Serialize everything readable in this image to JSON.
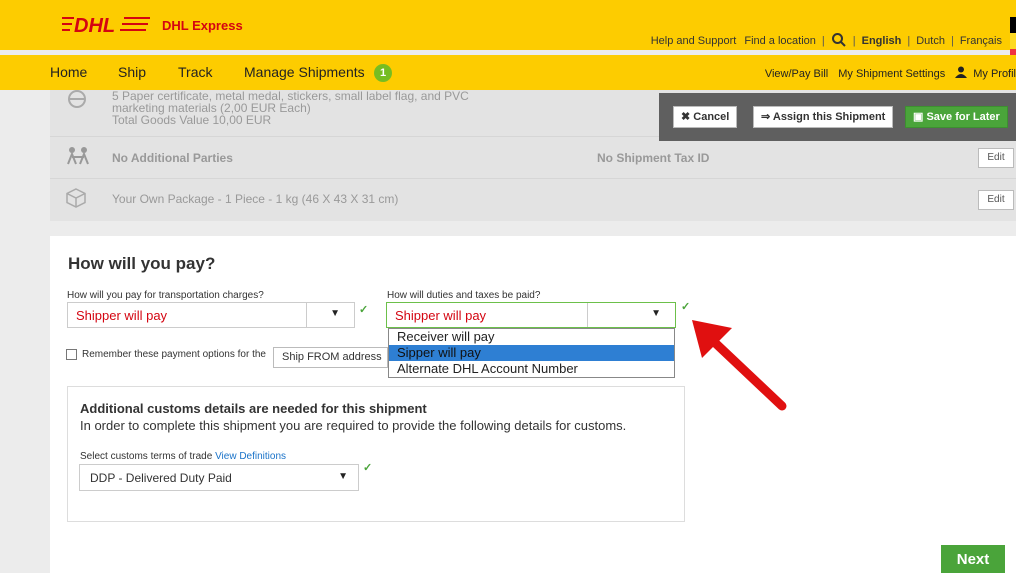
{
  "header": {
    "brand": "DHL Express",
    "links": [
      "Help and Support",
      "Find a location"
    ],
    "languages": [
      "English",
      "Dutch",
      "Français"
    ],
    "active_language": "English",
    "flag_colors": [
      "#000000",
      "#fdda24",
      "#ef3340"
    ]
  },
  "nav": {
    "home": "Home",
    "ship": "Ship",
    "track": "Track",
    "manage": "Manage Shipments",
    "badge": "1",
    "right": [
      "View/Pay Bill",
      "My Shipment Settings",
      "My Profil"
    ]
  },
  "summary": {
    "goods_line1": "5 Paper certificate, metal medal, stickers, small label flag, and PVC",
    "goods_line2": "marketing materials (2,00 EUR Each)",
    "goods_line3": "Total Goods Value 10,00 EUR",
    "parties": "No Additional Parties",
    "tax_id": "No Shipment Tax ID",
    "package": "Your Own Package - 1 Piece - 1 kg (46 X 43 X 31 cm)",
    "edit_label": "Edit"
  },
  "actions": {
    "cancel": "Cancel",
    "assign": "Assign this Shipment",
    "save": "Save for Later"
  },
  "payment": {
    "heading": "How will you pay?",
    "transport_label": "How will you pay for transportation charges?",
    "transport_value": "Shipper will pay",
    "duties_label": "How will duties and taxes be paid?",
    "duties_value": "Shipper will pay",
    "duties_options": [
      "Receiver will pay",
      "Sipper will pay",
      "Alternate DHL Account Number"
    ],
    "remember_label": "Remember these payment options for the",
    "remember_select": "Ship FROM address"
  },
  "customs": {
    "title": "Additional customs details are needed for this shipment",
    "text": "In order to complete this shipment you are required to provide the following details for customs.",
    "label": "Select customs terms of trade",
    "link": "View Definitions",
    "value": "DDP - Delivered Duty Paid"
  },
  "next_label": "Next",
  "colors": {
    "dhl_yellow": "#fdcc00",
    "dhl_red": "#d40511",
    "green": "#4aa43a",
    "highlight": "#2e7fd3"
  }
}
